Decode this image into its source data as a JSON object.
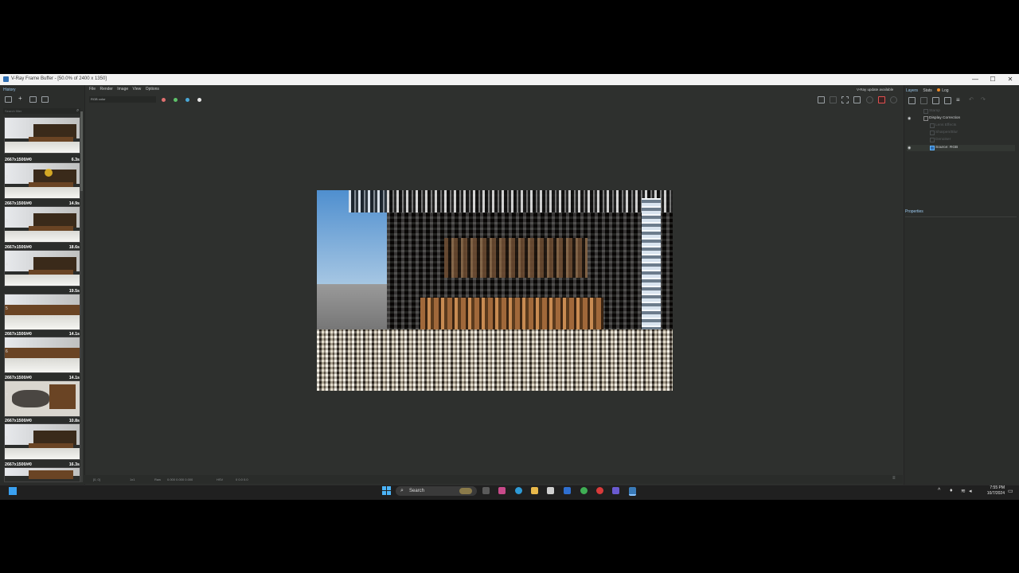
{
  "window": {
    "title": "V-Ray Frame Buffer - [50.0% of 2400 x 1350]",
    "controls": [
      "—",
      "☐",
      "✕"
    ]
  },
  "history": {
    "tab_label": "History",
    "filter_placeholder": "Search filter",
    "items": [
      {
        "index": "",
        "label": "2667x1500/#0",
        "time": "6.3s"
      },
      {
        "index": "2",
        "label": "2667x1500/#0",
        "time": "14.9s"
      },
      {
        "index": "3",
        "label": "2667x1500/#0",
        "time": "18.6s"
      },
      {
        "index": "4",
        "label": "",
        "time": "19.5s"
      },
      {
        "index": "5",
        "label": "2667x1500/#0",
        "time": "14.1s"
      },
      {
        "index": "6",
        "label": "2667x1500/#0",
        "time": "14.1s"
      },
      {
        "index": "7",
        "label": "2667x1500/#0",
        "time": "10.8s"
      },
      {
        "index": "8",
        "label": "2667x1500/#0",
        "time": "16.3s"
      }
    ]
  },
  "menu": {
    "items": [
      "File",
      "Render",
      "Image",
      "View",
      "Options"
    ]
  },
  "toolbar": {
    "channel_select": "RGB color",
    "update_notice": "V-Ray update available",
    "colors": {
      "red": "#e07070",
      "green": "#5ec26a",
      "blue": "#4aa8d8",
      "white": "#e8e8e8"
    }
  },
  "statusbar": {
    "coords": "[0, 0]",
    "mode": "1x1",
    "raw_label": "Raw",
    "values": "0.000   0.000   0.000",
    "hsv_label": "HSV",
    "hsv_values": "0     0.0   0.0"
  },
  "right_panel": {
    "tabs": [
      "Layers",
      "Stats",
      "Log"
    ],
    "layers": [
      {
        "name": "Stamp",
        "enabled": false,
        "visible": false,
        "indent": 1
      },
      {
        "name": "Display Correction",
        "enabled": true,
        "visible": true,
        "indent": 1
      },
      {
        "name": "Lens Effects",
        "enabled": false,
        "visible": false,
        "indent": 2
      },
      {
        "name": "Sharpen/Blur",
        "enabled": false,
        "visible": false,
        "indent": 2
      },
      {
        "name": "Denoiser",
        "enabled": false,
        "visible": false,
        "indent": 2
      },
      {
        "name": "Source: RGB",
        "enabled": true,
        "visible": true,
        "indent": 2
      }
    ],
    "properties_label": "Properties"
  },
  "taskbar": {
    "search_label": "Search",
    "time": "7:55 PM",
    "date": "10/7/2024"
  }
}
